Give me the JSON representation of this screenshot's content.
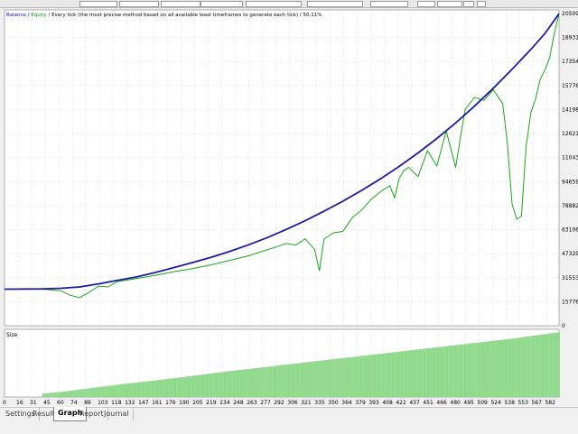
{
  "legend": {
    "balance": "Balance",
    "sep1": " / ",
    "equity": "Equity",
    "sep2": " / ",
    "model": "Every tick (the most precise method based on all available least timeframes to generate each tick)",
    "sep3": " / ",
    "quality": "50.11%"
  },
  "colors": {
    "balance": "#1c1ca0",
    "equity": "#1aa51a",
    "size_bars": "#8ed88a",
    "grid": "#c8c8c8",
    "legend_balance": "#0000cc",
    "legend_equity": "#009900"
  },
  "size_panel": {
    "label": "Size"
  },
  "y_axis": {
    "ticks": [
      "205094",
      "189318",
      "173541",
      "157765",
      "141988",
      "126212",
      "110435",
      "94659",
      "78882",
      "63106",
      "47329",
      "31553",
      "15776",
      "0"
    ]
  },
  "x_axis": {
    "ticks": [
      "0",
      "16",
      "31",
      "45",
      "60",
      "74",
      "89",
      "103",
      "118",
      "132",
      "147",
      "161",
      "176",
      "190",
      "205",
      "219",
      "234",
      "248",
      "263",
      "277",
      "292",
      "306",
      "321",
      "335",
      "350",
      "364",
      "379",
      "393",
      "408",
      "422",
      "437",
      "451",
      "466",
      "480",
      "495",
      "509",
      "524",
      "538",
      "553",
      "567",
      "582"
    ]
  },
  "chart_data": {
    "type": "line",
    "x_range": [
      0,
      590
    ],
    "y_range": [
      0,
      205094
    ],
    "series": [
      {
        "name": "Balance",
        "x": [
          0,
          40,
          60,
          80,
          100,
          120,
          140,
          160,
          180,
          200,
          220,
          240,
          260,
          280,
          300,
          320,
          340,
          360,
          380,
          400,
          420,
          440,
          460,
          480,
          500,
          520,
          540,
          560,
          575,
          590
        ],
        "values": [
          24000,
          24200,
          24600,
          25500,
          27500,
          29800,
          32000,
          34900,
          38200,
          41500,
          45000,
          48900,
          53200,
          58000,
          63300,
          69000,
          75200,
          81800,
          88900,
          96500,
          104700,
          113500,
          123000,
          133200,
          144200,
          156000,
          168500,
          181500,
          192000,
          205000
        ]
      },
      {
        "name": "Equity",
        "x": [
          0,
          40,
          60,
          70,
          80,
          90,
          100,
          110,
          120,
          140,
          160,
          180,
          200,
          220,
          240,
          260,
          280,
          290,
          300,
          310,
          320,
          330,
          335,
          340,
          345,
          350,
          360,
          370,
          380,
          390,
          400,
          410,
          415,
          420,
          425,
          430,
          440,
          450,
          460,
          470,
          480,
          490,
          500,
          510,
          520,
          530,
          535,
          540,
          545,
          550,
          555,
          560,
          565,
          570,
          575,
          580,
          585,
          590
        ],
        "values": [
          24000,
          24000,
          23000,
          20000,
          18500,
          22000,
          26000,
          25500,
          29000,
          31000,
          33000,
          35500,
          37500,
          40000,
          43000,
          46000,
          50000,
          52000,
          54000,
          53000,
          57000,
          50000,
          36000,
          57000,
          59000,
          61000,
          62000,
          71000,
          76000,
          83000,
          88000,
          92000,
          84000,
          97000,
          102000,
          104000,
          98000,
          115000,
          105000,
          128000,
          104000,
          142000,
          150000,
          148000,
          155000,
          146000,
          120000,
          80000,
          70000,
          72000,
          118000,
          140000,
          149000,
          162000,
          168000,
          176000,
          192000,
          205000
        ]
      },
      {
        "name": "Size",
        "x": [
          0,
          60,
          120,
          180,
          240,
          300,
          360,
          420,
          480,
          540,
          590
        ],
        "values": [
          0,
          0.08,
          0.19,
          0.29,
          0.4,
          0.5,
          0.6,
          0.7,
          0.8,
          0.9,
          1.0
        ]
      }
    ],
    "grid": true,
    "legend_position": "top-left"
  },
  "tabs": [
    {
      "label": "Settings",
      "active": false
    },
    {
      "label": "Results",
      "active": false
    },
    {
      "label": "Graph",
      "active": true
    },
    {
      "label": "Report",
      "active": false
    },
    {
      "label": "Journal",
      "active": false
    }
  ]
}
